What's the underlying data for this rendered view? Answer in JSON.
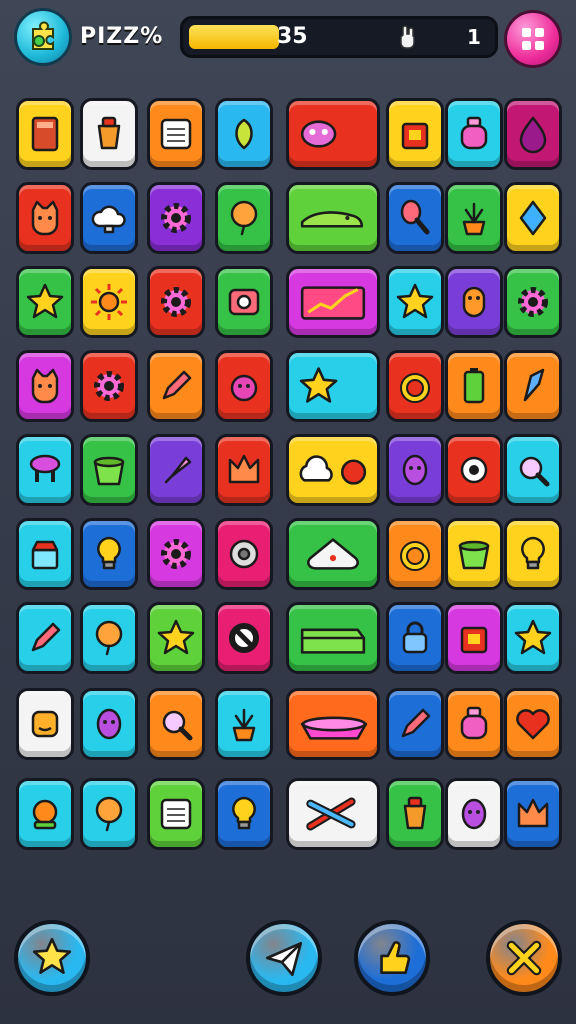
{
  "header": {
    "title": "PIZZ%",
    "score": "35",
    "count": "1",
    "progress_fraction": 0.3,
    "logo_icon": "puzzle-icon",
    "menu_icon": "grid-menu-icon"
  },
  "board": {
    "rows": [
      [
        {
          "icon": "book",
          "color": "#ffd21e"
        },
        {
          "icon": "cup",
          "color": "#f4f4f4"
        },
        {
          "icon": "calendar",
          "color": "#ff8a1c"
        },
        {
          "icon": "leaf",
          "color": "#2ab8f0"
        },
        {
          "icon": "bug",
          "color": "#e8321f",
          "wide": true
        },
        {
          "icon": "box",
          "color": "#ffd21e"
        },
        {
          "icon": "bottle",
          "color": "#27cfe8"
        },
        {
          "icon": "drop",
          "color": "#c21873"
        }
      ],
      [
        {
          "icon": "cat",
          "color": "#e8321f"
        },
        {
          "icon": "cloud",
          "color": "#1e6ed8"
        },
        {
          "icon": "gear",
          "color": "#8a2ed8"
        },
        {
          "icon": "balloon",
          "color": "#35c246"
        },
        {
          "icon": "lizard",
          "color": "#5fd13a",
          "wide": true
        },
        {
          "icon": "racket",
          "color": "#1e6ed8"
        },
        {
          "icon": "plant",
          "color": "#35c246"
        },
        {
          "icon": "diamond",
          "color": "#ffd21e"
        }
      ],
      [
        {
          "icon": "star",
          "color": "#35c246"
        },
        {
          "icon": "sun",
          "color": "#ffd21e"
        },
        {
          "icon": "gear",
          "color": "#e8321f"
        },
        {
          "icon": "camera",
          "color": "#35c246"
        },
        {
          "icon": "chart",
          "color": "#d639e0",
          "wide": true
        },
        {
          "icon": "star",
          "color": "#27cfe8"
        },
        {
          "icon": "monster",
          "color": "#7a3ed8"
        },
        {
          "icon": "gear",
          "color": "#35c246"
        }
      ],
      [
        {
          "icon": "cat",
          "color": "#d639e0"
        },
        {
          "icon": "gear",
          "color": "#e8321f"
        },
        {
          "icon": "pencil",
          "color": "#ff8a1c"
        },
        {
          "icon": "ball",
          "color": "#e8321f"
        },
        {
          "icon": "star",
          "color": "#27cfe8",
          "wide": true
        },
        {
          "icon": "ring",
          "color": "#e8321f"
        },
        {
          "icon": "battery",
          "color": "#ff8a1c"
        },
        {
          "icon": "blade",
          "color": "#ff8a1c"
        }
      ],
      [
        {
          "icon": "stool",
          "color": "#27cfe8"
        },
        {
          "icon": "pot",
          "color": "#35c246"
        },
        {
          "icon": "brush",
          "color": "#7a3ed8"
        },
        {
          "icon": "crown",
          "color": "#e8321f"
        },
        {
          "icon": "cloud-ball",
          "color": "#ffd21e",
          "wide": true
        },
        {
          "icon": "egg",
          "color": "#7a3ed8"
        },
        {
          "icon": "eye",
          "color": "#e8321f"
        },
        {
          "icon": "magnifier",
          "color": "#27cfe8"
        }
      ],
      [
        {
          "icon": "cake",
          "color": "#27cfe8"
        },
        {
          "icon": "bulb",
          "color": "#1e6ed8"
        },
        {
          "icon": "gear",
          "color": "#d639e0"
        },
        {
          "icon": "disc",
          "color": "#e81f73"
        },
        {
          "icon": "slime",
          "color": "#35c246",
          "wide": true
        },
        {
          "icon": "ring",
          "color": "#ff8a1c"
        },
        {
          "icon": "pot",
          "color": "#ffd21e"
        },
        {
          "icon": "bulb",
          "color": "#ffd21e"
        }
      ],
      [
        {
          "icon": "pencil",
          "color": "#27cfe8"
        },
        {
          "icon": "balloon",
          "color": "#27cfe8"
        },
        {
          "icon": "star",
          "color": "#5fd13a"
        },
        {
          "icon": "forbidden",
          "color": "#e81f73"
        },
        {
          "icon": "wallet",
          "color": "#35c246",
          "wide": true
        },
        {
          "icon": "lock",
          "color": "#1e6ed8"
        },
        {
          "icon": "box",
          "color": "#d639e0"
        },
        {
          "icon": "star",
          "color": "#27cfe8"
        }
      ],
      [
        {
          "icon": "face",
          "color": "#f4f4f4"
        },
        {
          "icon": "egg",
          "color": "#27cfe8"
        },
        {
          "icon": "magnifier",
          "color": "#ff8a1c"
        },
        {
          "icon": "plant",
          "color": "#27cfe8"
        },
        {
          "icon": "boat",
          "color": "#ff6a1c",
          "wide": true
        },
        {
          "icon": "pencil",
          "color": "#1e6ed8"
        },
        {
          "icon": "bottle",
          "color": "#ff8a1c"
        },
        {
          "icon": "heart",
          "color": "#ff8a1c"
        }
      ],
      [
        {
          "icon": "crystal",
          "color": "#27cfe8"
        },
        {
          "icon": "balloon",
          "color": "#27cfe8"
        },
        {
          "icon": "calendar",
          "color": "#5fd13a"
        },
        {
          "icon": "bulb",
          "color": "#1e6ed8"
        },
        {
          "icon": "tools",
          "color": "#f4f4f4",
          "wide": true
        },
        {
          "icon": "cup",
          "color": "#35c246"
        },
        {
          "icon": "egg",
          "color": "#f4f4f4"
        },
        {
          "icon": "crown",
          "color": "#1e6ed8"
        }
      ]
    ]
  },
  "footer": {
    "buttons": [
      {
        "name": "favorites-button",
        "icon": "star-icon",
        "color": "#2ab8f0"
      },
      {
        "name": "send-button",
        "icon": "paper-plane-icon",
        "color": "#2ab8f0"
      },
      {
        "name": "hint-button",
        "icon": "thumbs-up-icon",
        "color": "#1e6ed8"
      },
      {
        "name": "tools-button",
        "icon": "crossed-tools-icon",
        "color": "#ff8a1c"
      }
    ]
  }
}
